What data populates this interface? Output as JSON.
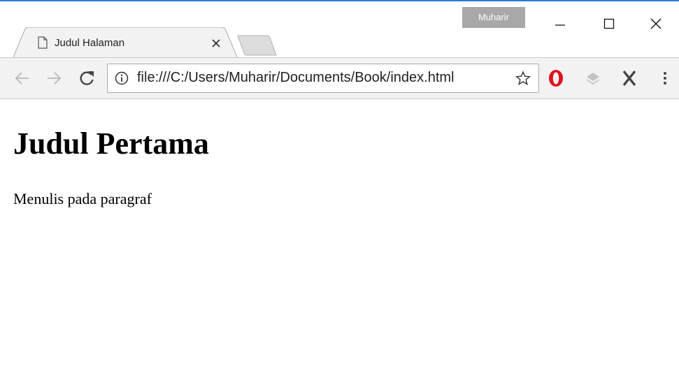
{
  "window": {
    "profile_name": "Muharir",
    "accent_color": "#2b7cd3"
  },
  "tabs": [
    {
      "title": "Judul Halaman",
      "icon": "document-icon",
      "active": true
    }
  ],
  "toolbar": {
    "url": "file:///C:/Users/Muharir/Documents/Book/index.html",
    "icons": [
      "back-arrow-icon",
      "forward-arrow-icon",
      "reload-icon",
      "info-icon",
      "star-icon",
      "opera-icon",
      "layers-icon",
      "x-extension-icon",
      "menu-kebab-icon"
    ]
  },
  "page": {
    "heading": "Judul Pertama",
    "paragraph": "Menulis pada paragraf"
  }
}
